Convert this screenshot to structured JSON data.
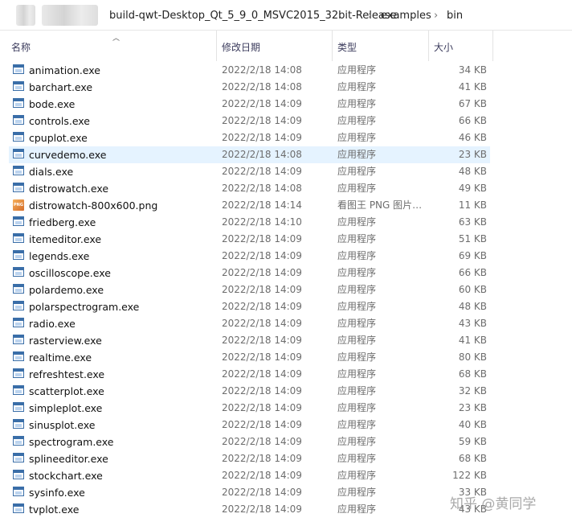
{
  "breadcrumb": {
    "items": [
      "build-qwt-Desktop_Qt_5_9_0_MSVC2015_32bit-Release",
      "examples",
      "bin"
    ],
    "separator": "›"
  },
  "columns": {
    "name": "名称",
    "date": "修改日期",
    "type": "类型",
    "size": "大小"
  },
  "files": [
    {
      "name": "animation.exe",
      "date": "2022/2/18 14:08",
      "type": "应用程序",
      "size": "34 KB",
      "icon": "exe-icon"
    },
    {
      "name": "barchart.exe",
      "date": "2022/2/18 14:08",
      "type": "应用程序",
      "size": "41 KB",
      "icon": "exe-icon"
    },
    {
      "name": "bode.exe",
      "date": "2022/2/18 14:09",
      "type": "应用程序",
      "size": "67 KB",
      "icon": "exe-icon"
    },
    {
      "name": "controls.exe",
      "date": "2022/2/18 14:09",
      "type": "应用程序",
      "size": "66 KB",
      "icon": "exe-icon"
    },
    {
      "name": "cpuplot.exe",
      "date": "2022/2/18 14:09",
      "type": "应用程序",
      "size": "46 KB",
      "icon": "exe-icon"
    },
    {
      "name": "curvedemo.exe",
      "date": "2022/2/18 14:08",
      "type": "应用程序",
      "size": "23 KB",
      "icon": "exe-icon",
      "selected": true
    },
    {
      "name": "dials.exe",
      "date": "2022/2/18 14:09",
      "type": "应用程序",
      "size": "48 KB",
      "icon": "exe-icon"
    },
    {
      "name": "distrowatch.exe",
      "date": "2022/2/18 14:08",
      "type": "应用程序",
      "size": "49 KB",
      "icon": "exe-icon"
    },
    {
      "name": "distrowatch-800x600.png",
      "date": "2022/2/18 14:14",
      "type": "看图王 PNG 图片…",
      "size": "11 KB",
      "icon": "png-icon"
    },
    {
      "name": "friedberg.exe",
      "date": "2022/2/18 14:10",
      "type": "应用程序",
      "size": "63 KB",
      "icon": "exe-icon"
    },
    {
      "name": "itemeditor.exe",
      "date": "2022/2/18 14:09",
      "type": "应用程序",
      "size": "51 KB",
      "icon": "exe-icon"
    },
    {
      "name": "legends.exe",
      "date": "2022/2/18 14:09",
      "type": "应用程序",
      "size": "69 KB",
      "icon": "exe-icon"
    },
    {
      "name": "oscilloscope.exe",
      "date": "2022/2/18 14:09",
      "type": "应用程序",
      "size": "66 KB",
      "icon": "exe-icon"
    },
    {
      "name": "polardemo.exe",
      "date": "2022/2/18 14:09",
      "type": "应用程序",
      "size": "60 KB",
      "icon": "exe-icon"
    },
    {
      "name": "polarspectrogram.exe",
      "date": "2022/2/18 14:09",
      "type": "应用程序",
      "size": "48 KB",
      "icon": "exe-icon"
    },
    {
      "name": "radio.exe",
      "date": "2022/2/18 14:09",
      "type": "应用程序",
      "size": "43 KB",
      "icon": "exe-icon"
    },
    {
      "name": "rasterview.exe",
      "date": "2022/2/18 14:09",
      "type": "应用程序",
      "size": "41 KB",
      "icon": "exe-icon"
    },
    {
      "name": "realtime.exe",
      "date": "2022/2/18 14:09",
      "type": "应用程序",
      "size": "80 KB",
      "icon": "exe-icon"
    },
    {
      "name": "refreshtest.exe",
      "date": "2022/2/18 14:09",
      "type": "应用程序",
      "size": "68 KB",
      "icon": "exe-icon"
    },
    {
      "name": "scatterplot.exe",
      "date": "2022/2/18 14:09",
      "type": "应用程序",
      "size": "32 KB",
      "icon": "exe-icon"
    },
    {
      "name": "simpleplot.exe",
      "date": "2022/2/18 14:09",
      "type": "应用程序",
      "size": "23 KB",
      "icon": "exe-icon"
    },
    {
      "name": "sinusplot.exe",
      "date": "2022/2/18 14:09",
      "type": "应用程序",
      "size": "40 KB",
      "icon": "exe-icon"
    },
    {
      "name": "spectrogram.exe",
      "date": "2022/2/18 14:09",
      "type": "应用程序",
      "size": "59 KB",
      "icon": "exe-icon"
    },
    {
      "name": "splineeditor.exe",
      "date": "2022/2/18 14:09",
      "type": "应用程序",
      "size": "68 KB",
      "icon": "exe-icon"
    },
    {
      "name": "stockchart.exe",
      "date": "2022/2/18 14:09",
      "type": "应用程序",
      "size": "122 KB",
      "icon": "exe-icon"
    },
    {
      "name": "sysinfo.exe",
      "date": "2022/2/18 14:09",
      "type": "应用程序",
      "size": "33 KB",
      "icon": "exe-icon"
    },
    {
      "name": "tvplot.exe",
      "date": "2022/2/18 14:09",
      "type": "应用程序",
      "size": "43 KB",
      "icon": "exe-icon"
    }
  ],
  "watermark": "知乎 @黄同学",
  "colors": {
    "selection": "#e5f3ff",
    "header_text": "#3b3b5c",
    "secondary_text": "#6d6d6d"
  }
}
